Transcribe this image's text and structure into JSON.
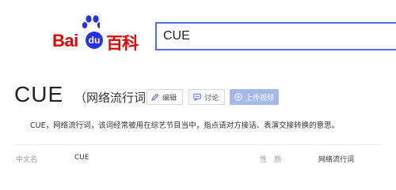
{
  "logo": {
    "bai_text": "Bai",
    "du_text": "du",
    "baike_text": "百科",
    "paw_color": "#2932e1",
    "brand_red": "#e10601"
  },
  "search": {
    "value": "CUE",
    "border_color": "#4e6ef2"
  },
  "entry": {
    "title": "CUE",
    "subtitle": "（网络流行词）",
    "buttons": {
      "edit_label": "编辑",
      "edit_icon": "pencil-icon",
      "discuss_label": "讨论",
      "discuss_icon": "chat-icon",
      "upload_label": "上传视频",
      "upload_icon": "plus-circle-icon",
      "upload_color": "#a3b9e8"
    },
    "summary": "CUE，网络流行词，该词经常被用在综艺节目当中，指点请对方接话、表演交接转换的意思。"
  },
  "basic_info": {
    "chinese_name_label": "中文名",
    "chinese_name_value": "CUE",
    "nature_label": "性　质",
    "nature_value": "网络流行词"
  }
}
